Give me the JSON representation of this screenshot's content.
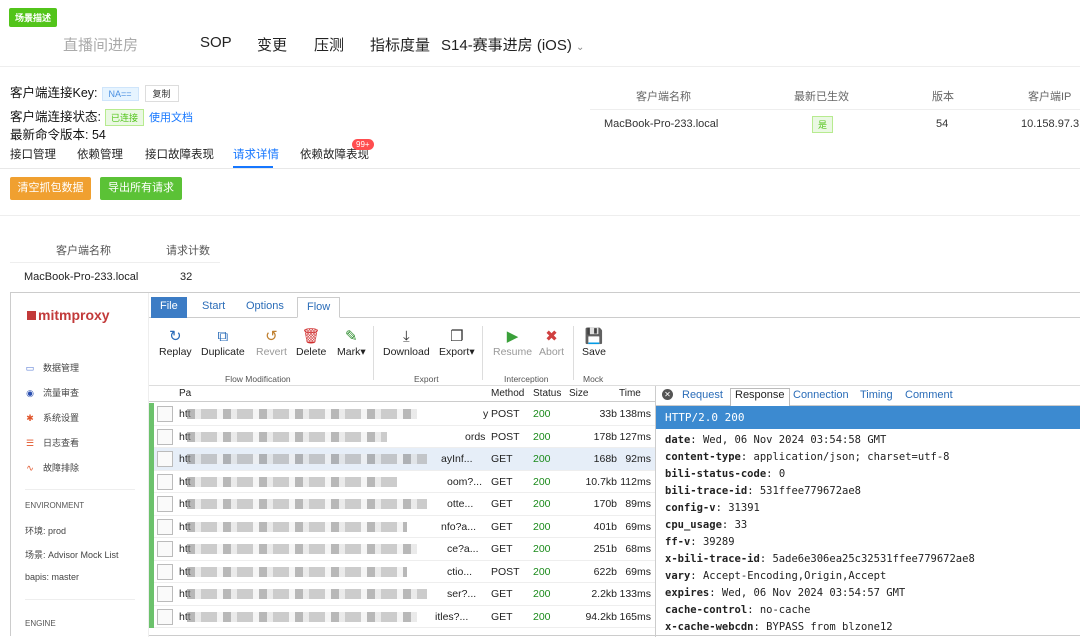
{
  "scene_badge": "场景描述",
  "top_nav": {
    "items": [
      {
        "label": "直播间进房",
        "dim": true
      },
      {
        "label": "SOP"
      },
      {
        "label": "变更"
      },
      {
        "label": "压测"
      },
      {
        "label": "指标度量"
      },
      {
        "label": "S14-赛事进房 (iOS)"
      }
    ]
  },
  "client_info": {
    "key_label": "客户端连接Key:",
    "key_value": "NA==",
    "copy_label": "复制",
    "status_label": "客户端连接状态:",
    "status_value": "已连接",
    "doc_link": "使用文档",
    "version_line": "最新命令版本: 54"
  },
  "client_table": {
    "headers": [
      "客户端名称",
      "最新已生效",
      "版本",
      "客户端IP"
    ],
    "row": {
      "name": "MacBook-Pro-233.local",
      "effective": "是",
      "version": "54",
      "ip": "10.158.97.31"
    }
  },
  "tabs": [
    {
      "label": "接口管理"
    },
    {
      "label": "依赖管理"
    },
    {
      "label": "接口故障表现"
    },
    {
      "label": "请求详情",
      "active": true
    },
    {
      "label": "依赖故障表现"
    }
  ],
  "badge_count": "99+",
  "buttons": {
    "clear": "清空抓包数据",
    "export": "导出所有请求"
  },
  "count_table": {
    "headers": [
      "客户端名称",
      "请求计数"
    ],
    "row": {
      "name": "MacBook-Pro-233.local",
      "count": "32"
    }
  },
  "mitm": {
    "logo": "mitmproxy",
    "sidebar": {
      "items": [
        {
          "icon": "monitor-icon",
          "glyph": "▭",
          "label": "数据管理",
          "color": "#4a6fd0"
        },
        {
          "icon": "traffic-icon",
          "glyph": "◉",
          "label": "流量审查",
          "color": "#2a4fb0"
        },
        {
          "icon": "settings-icon",
          "glyph": "✱",
          "label": "系统设置",
          "color": "#e0542a"
        },
        {
          "icon": "log-icon",
          "glyph": "☰",
          "label": "日志查看",
          "color": "#e0542a"
        },
        {
          "icon": "pulse-icon",
          "glyph": "∿",
          "label": "故障排除",
          "color": "#e0542a"
        }
      ],
      "env_label": "ENVIRONMENT",
      "env_lines": [
        "环境: prod",
        "场景: Advisor Mock List",
        "bapis: master"
      ],
      "engine_label": "ENGINE"
    },
    "ribbon_tabs": [
      "File",
      "Start",
      "Options",
      "Flow"
    ],
    "ribbon": {
      "buttons": [
        {
          "label": "Replay",
          "glyph": "↻",
          "color": "#2a6cb8"
        },
        {
          "label": "Duplicate",
          "glyph": "⧉",
          "color": "#2a6cb8"
        },
        {
          "label": "Revert",
          "glyph": "↺",
          "color": "#c08030",
          "disabled": true
        },
        {
          "label": "Delete",
          "glyph": "🗑",
          "color": "#d03030"
        },
        {
          "label": "Mark▾",
          "glyph": "✎",
          "color": "#2a8a2a"
        },
        {
          "label": "Download",
          "glyph": "⤓",
          "color": "#333"
        },
        {
          "label": "Export▾",
          "glyph": "❐",
          "color": "#333"
        },
        {
          "label": "Resume",
          "glyph": "▶",
          "color": "#3aa03a",
          "disabled": true
        },
        {
          "label": "Abort",
          "glyph": "✖",
          "color": "#d04040",
          "disabled": true
        },
        {
          "label": "Save",
          "glyph": "💾",
          "color": "#2a6cb8"
        }
      ],
      "groups": [
        "Flow Modification",
        "Export",
        "Interception",
        "Mock"
      ]
    },
    "flow_headers": [
      "Pa",
      "Method",
      "Status",
      "Size",
      "Time"
    ],
    "flows": [
      {
        "path": "htt",
        "tail": "y",
        "method": "POST",
        "status": "200",
        "size": "33b",
        "time": "138ms"
      },
      {
        "path": "htt",
        "tail": "ords",
        "method": "POST",
        "status": "200",
        "size": "178b",
        "time": "127ms"
      },
      {
        "path": "htt",
        "tail": "ayInf...",
        "method": "GET",
        "status": "200",
        "size": "168b",
        "time": "92ms",
        "selected": true
      },
      {
        "path": "htt",
        "tail": "oom?...",
        "method": "GET",
        "status": "200",
        "size": "10.7kb",
        "time": "112ms"
      },
      {
        "path": "htt",
        "tail": "otte...",
        "method": "GET",
        "status": "200",
        "size": "170b",
        "time": "89ms"
      },
      {
        "path": "htt",
        "tail": "nfo?a...",
        "method": "GET",
        "status": "200",
        "size": "401b",
        "time": "69ms"
      },
      {
        "path": "htt",
        "tail": "ce?a...",
        "method": "GET",
        "status": "200",
        "size": "251b",
        "time": "68ms"
      },
      {
        "path": "htt",
        "tail": "ctio...",
        "method": "POST",
        "status": "200",
        "size": "622b",
        "time": "69ms"
      },
      {
        "path": "htt",
        "tail": "ser?...",
        "method": "GET",
        "status": "200",
        "size": "2.2kb",
        "time": "133ms"
      },
      {
        "path": "htt",
        "tail": "itles?...",
        "method": "GET",
        "status": "200",
        "size": "94.2kb",
        "time": "165ms"
      }
    ],
    "detail_tabs": [
      "Request",
      "Response",
      "Connection",
      "Timing",
      "Comment"
    ],
    "detail_status": "HTTP/2.0 200",
    "headers": [
      {
        "k": "date",
        "v": "Wed, 06 Nov 2024 03:54:58 GMT"
      },
      {
        "k": "content-type",
        "v": "application/json; charset=utf-8"
      },
      {
        "k": "bili-status-code",
        "v": "0"
      },
      {
        "k": "bili-trace-id",
        "v": "531ffee779672ae8"
      },
      {
        "k": "config-v",
        "v": "31391"
      },
      {
        "k": "cpu_usage",
        "v": "33"
      },
      {
        "k": "ff-v",
        "v": "39289"
      },
      {
        "k": "x-bili-trace-id",
        "v": "5ade6e306ea25c32531ffee779672ae8"
      },
      {
        "k": "vary",
        "v": "Accept-Encoding,Origin,Accept"
      },
      {
        "k": "expires",
        "v": "Wed, 06 Nov 2024 03:54:57 GMT"
      },
      {
        "k": "cache-control",
        "v": "no-cache"
      },
      {
        "k": "x-cache-webcdn",
        "v": "BYPASS from blzone12"
      }
    ]
  }
}
